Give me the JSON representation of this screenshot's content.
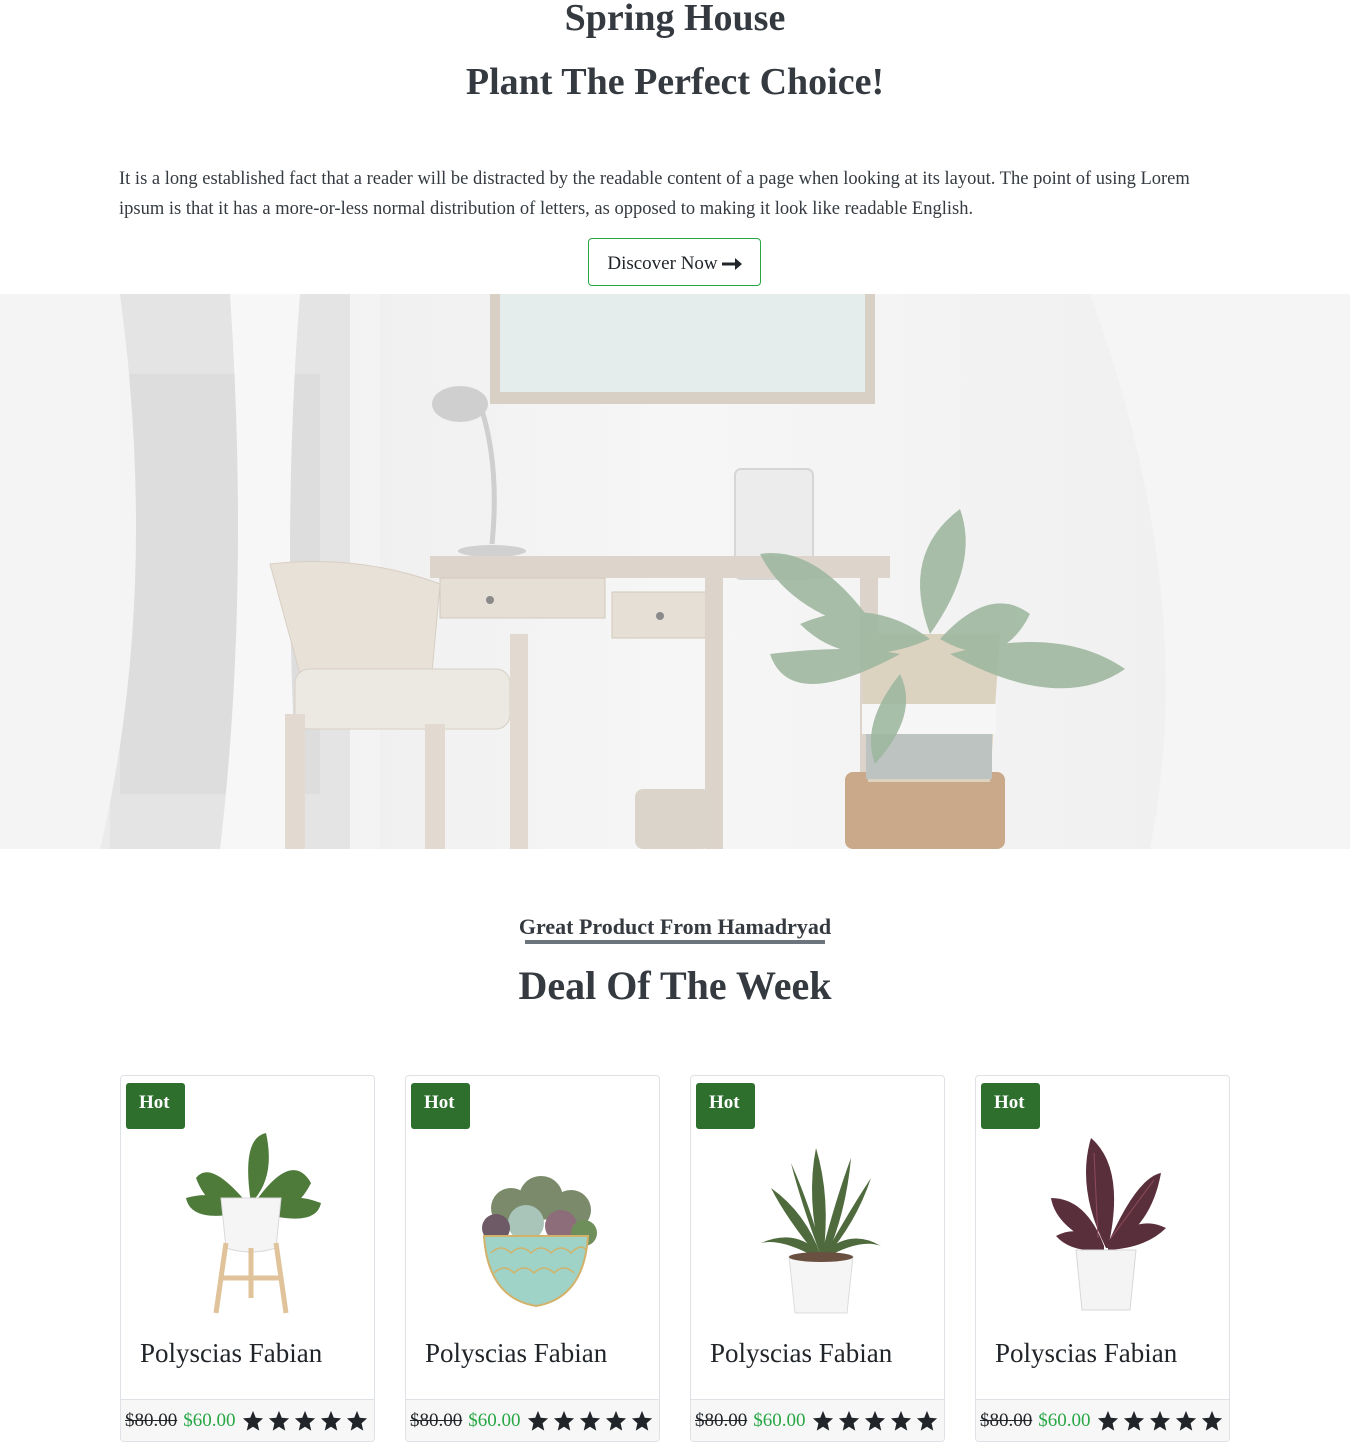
{
  "hero": {
    "title": "Spring House",
    "subtitle": "Plant The Perfect Choice!",
    "text": "It is a long established fact that a reader will be distracted by the readable content of a page when looking at its layout. The point of using Lorem ipsum is that it has a more-or-less normal distribution of letters, as opposed to making it look like readable English.",
    "button_label": "Discover Now",
    "button_icon": "arrow-right-icon"
  },
  "deals": {
    "label": "Great Product From Hamadryad",
    "title": "Deal Of The Week",
    "products": [
      {
        "badge": "Hot",
        "name": "Polyscias Fabian",
        "old_price": "$80.00",
        "new_price": "$60.00",
        "rating": 5,
        "plant_icon": "potted-plant-on-stand"
      },
      {
        "badge": "Hot",
        "name": "Polyscias Fabian",
        "old_price": "$80.00",
        "new_price": "$60.00",
        "rating": 5,
        "plant_icon": "succulent-bowl"
      },
      {
        "badge": "Hot",
        "name": "Polyscias Fabian",
        "old_price": "$80.00",
        "new_price": "$60.00",
        "rating": 5,
        "plant_icon": "snake-plant-pot"
      },
      {
        "badge": "Hot",
        "name": "Polyscias Fabian",
        "old_price": "$80.00",
        "new_price": "$60.00",
        "rating": 5,
        "plant_icon": "calathea-pot"
      }
    ]
  },
  "colors": {
    "accent": "#28a745",
    "badge": "#2e6f2e",
    "text": "#343a40"
  }
}
